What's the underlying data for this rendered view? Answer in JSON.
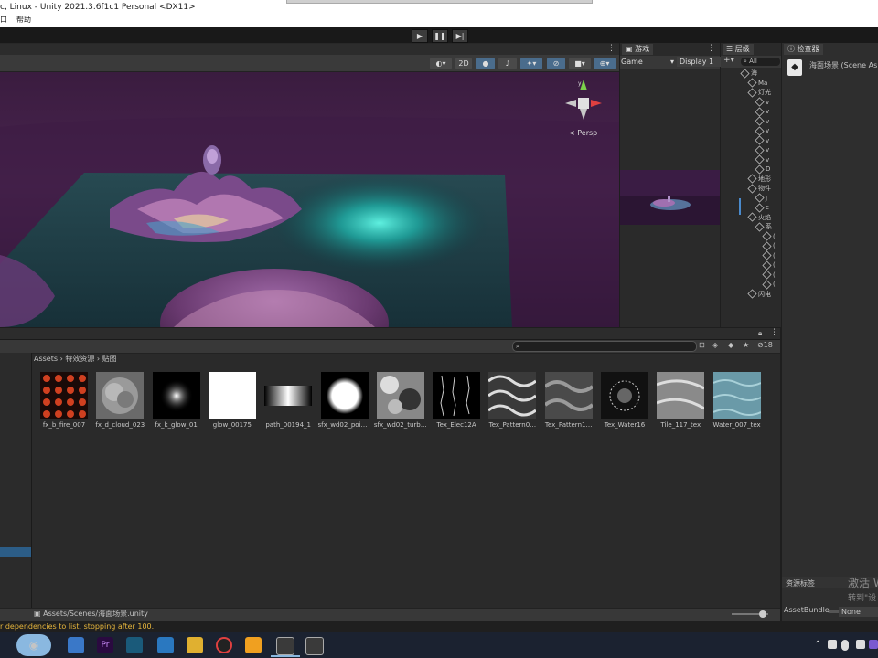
{
  "window": {
    "title": "c, Linux - Unity 2021.3.6f1c1 Personal <DX11>",
    "menu": [
      "口",
      "帮助"
    ]
  },
  "playbar": {
    "play": "▶",
    "pause": "❚❚",
    "step": "▶|"
  },
  "scene": {
    "toolbar_2d": "2D",
    "gizmo_label": "< Persp",
    "more": "⋮"
  },
  "game": {
    "tab": "游戏",
    "display_dropdown": "Game",
    "display_select": "Display 1"
  },
  "hierarchy": {
    "tab": "层级",
    "add": "+▾",
    "search": "All",
    "items": [
      {
        "label": "海",
        "indent": 0
      },
      {
        "label": "Ma",
        "indent": 1
      },
      {
        "label": "灯光",
        "indent": 1
      },
      {
        "label": "v",
        "indent": 2
      },
      {
        "label": "v",
        "indent": 2
      },
      {
        "label": "v",
        "indent": 2
      },
      {
        "label": "v",
        "indent": 2
      },
      {
        "label": "v",
        "indent": 2
      },
      {
        "label": "v",
        "indent": 2
      },
      {
        "label": "v",
        "indent": 2
      },
      {
        "label": "D",
        "indent": 2
      },
      {
        "label": "地形",
        "indent": 1
      },
      {
        "label": "物件",
        "indent": 1
      },
      {
        "label": "J",
        "indent": 2
      },
      {
        "label": "c",
        "indent": 2
      },
      {
        "label": "火焰",
        "indent": 1
      },
      {
        "label": "系",
        "indent": 2
      },
      {
        "label": "(",
        "indent": 3
      },
      {
        "label": "(",
        "indent": 3
      },
      {
        "label": "(",
        "indent": 3
      },
      {
        "label": "(",
        "indent": 3
      },
      {
        "label": "(",
        "indent": 3
      },
      {
        "label": "(",
        "indent": 3
      },
      {
        "label": "闪电",
        "indent": 1
      }
    ]
  },
  "inspector": {
    "tab": "检查器",
    "object_name": "海面场景 (Scene As",
    "asset_labels": "资源标签",
    "activate": "激活 W",
    "activate_sub": "转到\"设",
    "assetbundle_label": "AssetBundle",
    "assetbundle_value": "None"
  },
  "project": {
    "breadcrumb": [
      "Assets",
      "特效资源",
      "贴图"
    ],
    "hidden_count": "18",
    "footer_path": "Assets/Scenes/海面场景.unity",
    "assets": [
      {
        "name": "fx_b_fire_007",
        "kind": "fire"
      },
      {
        "name": "fx_d_cloud_023",
        "kind": "cloud"
      },
      {
        "name": "fx_k_glow_01",
        "kind": "glow"
      },
      {
        "name": "glow_00175",
        "kind": "white"
      },
      {
        "name": "path_00194_1",
        "kind": "path"
      },
      {
        "name": "sfx_wd02_poin…",
        "kind": "point"
      },
      {
        "name": "sfx_wd02_turb…",
        "kind": "turb"
      },
      {
        "name": "Tex_Elec12A",
        "kind": "elec"
      },
      {
        "name": "Tex_Pattern0…",
        "kind": "pattern"
      },
      {
        "name": "Tex_Pattern1…",
        "kind": "pattern2"
      },
      {
        "name": "Tex_Water16",
        "kind": "water16"
      },
      {
        "name": "Tile_117_tex",
        "kind": "tile"
      },
      {
        "name": "Water_007_tex",
        "kind": "water"
      }
    ]
  },
  "status": {
    "message": "r dependencies to list, stopping after 100."
  },
  "colors": {
    "accent_selection": "#2c5d87",
    "status_warning": "#e6b53c",
    "scene_sky": "#3a1c3f"
  }
}
